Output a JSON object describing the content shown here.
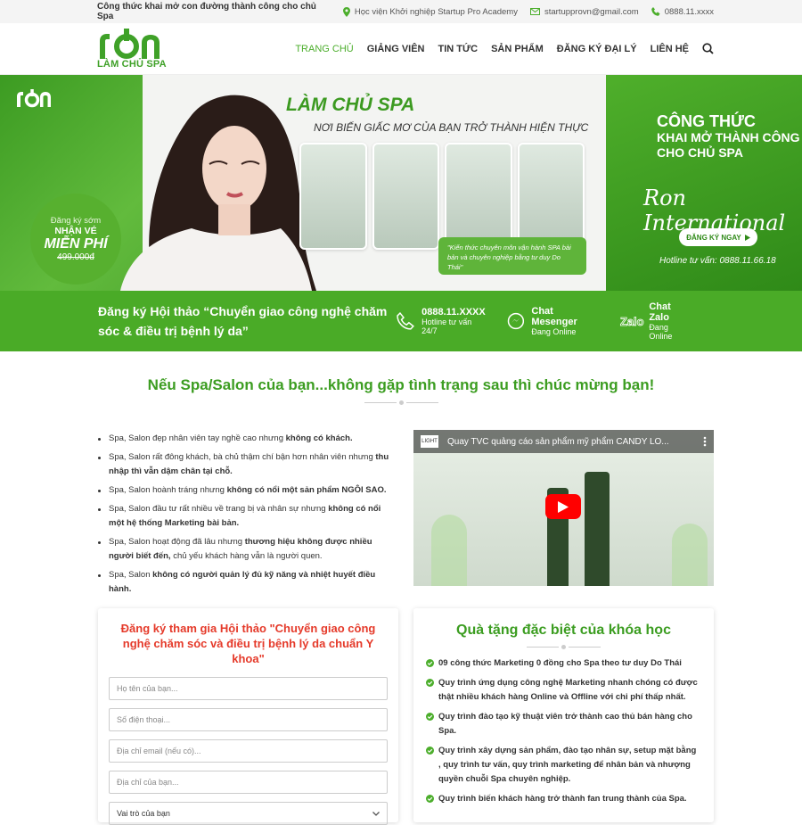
{
  "topbar": {
    "tagline": "Công thức khai mở con đường thành công cho chủ Spa",
    "address": "Học viện Khởi nghiệp Startup Pro Academy",
    "email": "startupprovn@gmail.com",
    "phone": "0888.11.xxxx"
  },
  "brand": {
    "logo_sub": "LÀM CHỦ SPA"
  },
  "nav": {
    "items": [
      "TRANG CHỦ",
      "GIẢNG VIÊN",
      "TIN TỨC",
      "SẢN PHẨM",
      "ĐĂNG KÝ ĐẠI LÝ",
      "LIÊN HỆ"
    ]
  },
  "banner": {
    "promo_line1": "Đăng ký sớm",
    "promo_line2": "NHẬN VÉ",
    "promo_line3": "MIỄN PHÍ",
    "promo_price": "499.000đ",
    "headline": "LÀM CHỦ SPA",
    "subheadline": "NƠI BIẾN GIẤC MƠ CỦA BẠN TRỞ THÀNH HIỆN THỰC",
    "quote": "\"Kiến thức chuyên môn vận hành SPA bài bản và chuyên nghiệp bằng tư duy Do Thái\"",
    "right_line1": "CÔNG THỨC",
    "right_line2": "KHAI MỞ THÀNH CÔNG CHO CHỦ SPA",
    "signature": "Ron International",
    "cta": "ĐĂNG KÝ NGAY",
    "hotline": "Hotline tư vấn: 0888.11.66.18"
  },
  "greenbar": {
    "title": "Đăng ký Hội thảo “Chuyển giao công nghệ chăm sóc & điều trị bệnh lý da”",
    "phone": "0888.11.XXXX",
    "phone_sub": "Hotline tư vấn 24/7",
    "messenger": "Chat Mesenger",
    "messenger_sub": "Đang Online",
    "zalo": "Chat Zalo",
    "zalo_sub": "Đang Online"
  },
  "section": {
    "title": "Nếu Spa/Salon của bạn...không gặp tình trạng sau thì chúc mừng bạn!",
    "bullets": [
      {
        "text": "Spa, Salon đẹp nhân viên tay nghề cao nhưng ",
        "bold": "không có khách."
      },
      {
        "text": "Spa, Salon rất đông khách, bà chủ thậm chí bận hơn nhân viên nhưng ",
        "bold": "thu nhập thì vẫn dậm chân tại chỗ."
      },
      {
        "text": "Spa, Salon hoành tráng nhưng ",
        "bold": "không có nổi một sản phẩm NGÔI SAO."
      },
      {
        "text": "Spa, Salon đầu tư rất nhiều về trang bị và nhân sự nhưng ",
        "bold": "không có nổi một hệ thống Marketing bài bản."
      },
      {
        "text": "Spa, Salon hoạt động đã lâu nhưng ",
        "bold": "thương hiệu không được nhiều người biết đến,",
        "tail": " chủ yếu khách hàng vẫn là người quen."
      },
      {
        "text": "Spa, Salon ",
        "bold": "không có người quản lý đủ kỹ năng và nhiệt huyết điều hành."
      }
    ],
    "video_title": "Quay TVC quảng cáo sản phẩm mỹ phẩm CANDY LO..."
  },
  "form": {
    "title": "Đăng ký tham gia Hội thảo \"Chuyển giao công nghệ chăm sóc và điều trị bệnh lý da chuẩn Y khoa\"",
    "name_placeholder": "Họ tên của bạn...",
    "phone_placeholder": "Số điện thoại...",
    "email_placeholder": "Địa chỉ email (nếu có)...",
    "address_placeholder": "Địa chỉ của bạn...",
    "role_selected": "Vai trò của bạn"
  },
  "gifts": {
    "title": "Quà tặng đặc biệt của khóa học",
    "items": [
      "09 công thức Marketing 0 đồng cho Spa theo tư duy Do Thái",
      "Quy trình ứng dụng công nghệ Marketing nhanh chóng có được thật nhiều khách hàng Online và Offline với chi phí thấp nhất.",
      "Quy trình đào tạo kỹ thuật viên trở thành cao thủ bán hàng cho Spa.",
      "Quy trình xây dựng sản phẩm, đào tạo nhân sự, setup mặt bằng , quy trình tư vấn, quy trình marketing để nhân bản và nhượng quyền chuỗi Spa chuyên nghiệp.",
      "Quy trình biến khách hàng trở thành fan trung thành của Spa."
    ]
  },
  "colors": {
    "brand_green": "#4cae2c",
    "form_red": "#e53a2a"
  }
}
